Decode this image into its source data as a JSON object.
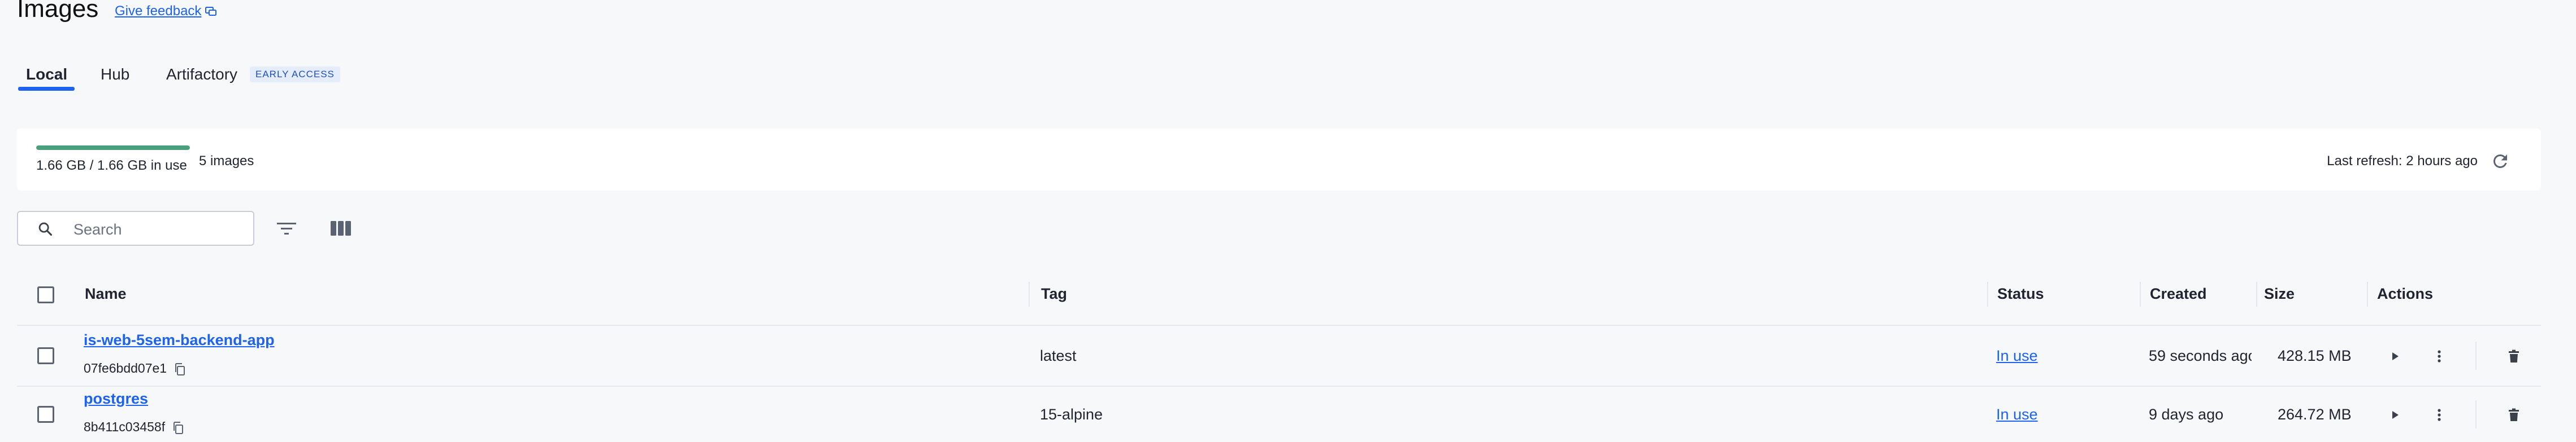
{
  "header": {
    "title": "Images",
    "feedback_label": "Give feedback"
  },
  "tabs": [
    {
      "label": "Local",
      "active": true
    },
    {
      "label": "Hub"
    },
    {
      "label": "Artifactory",
      "badge": "EARLY ACCESS"
    }
  ],
  "disk": {
    "used_fraction": 1.0,
    "usage_text": "1.66 GB / 1.66 GB in use",
    "images_count": "5 images",
    "last_refresh": "Last refresh: 2 hours ago"
  },
  "toolbar": {
    "search_placeholder": "Search",
    "filter_icon": "filter-icon",
    "columns_icon": "columns-icon"
  },
  "table": {
    "columns": [
      "Name",
      "Tag",
      "Status",
      "Created",
      "Size",
      "Actions"
    ],
    "rows": [
      {
        "name": "is-web-5sem-backend-app",
        "id": "07fe6bdd07e1",
        "tag": "latest",
        "status": "In use",
        "created": "59 seconds ago",
        "size": "428.15 MB"
      },
      {
        "name": "postgres",
        "id": "8b411c03458f",
        "tag": "15-alpine",
        "status": "In use",
        "created": "9 days ago",
        "size": "264.72 MB"
      }
    ]
  },
  "colors": {
    "accent": "#1d63ed",
    "usage_bar": "#4aa07d",
    "background": "#f7f8fa"
  },
  "icons": [
    "feedback-icon",
    "refresh-icon",
    "search-icon",
    "filter-icon",
    "columns-icon",
    "copy-icon",
    "play-icon",
    "more-icon",
    "trash-icon"
  ]
}
